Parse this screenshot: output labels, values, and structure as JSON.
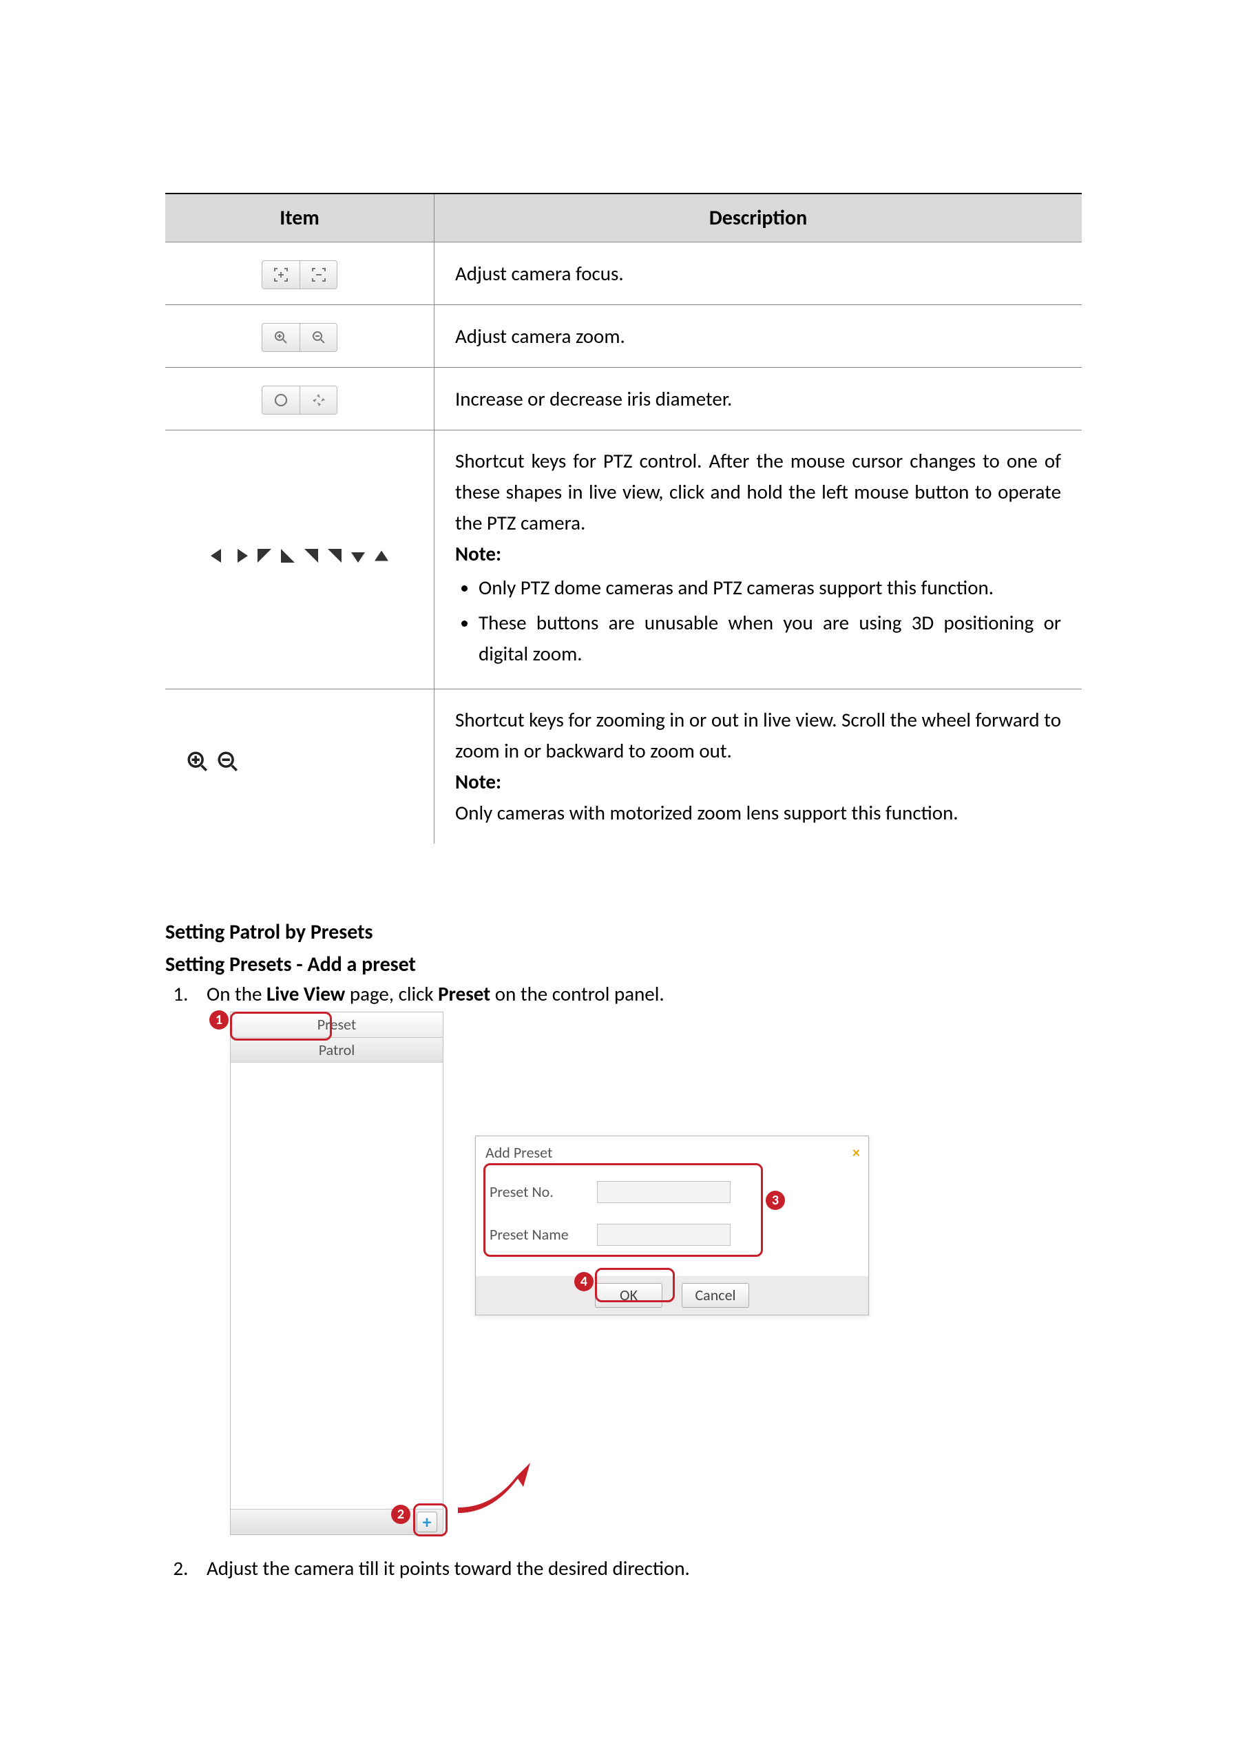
{
  "table": {
    "headers": {
      "item": "Item",
      "desc": "Description"
    },
    "rows": {
      "focus": {
        "desc": "Adjust camera focus."
      },
      "zoom": {
        "desc": "Adjust camera zoom."
      },
      "iris": {
        "desc": "Increase or decrease iris diameter."
      },
      "ptz": {
        "desc": "Shortcut keys for PTZ control. After the mouse cursor changes to one of these shapes in live view, click and hold the left mouse button to operate the PTZ camera.",
        "note_label": "Note:",
        "notes": [
          "Only PTZ dome cameras and PTZ cameras support this function.",
          "These buttons are unusable when you are using 3D positioning or digital zoom."
        ]
      },
      "scroll": {
        "desc": "Shortcut keys for zooming in or out in live view. Scroll the wheel forward to zoom in or backward to zoom out.",
        "note_label": "Note:",
        "note_line": "Only cameras with motorized zoom lens support this function."
      }
    }
  },
  "section": {
    "h1": "Setting Patrol by Presets",
    "h2": "Setting Presets - Add a preset"
  },
  "steps": {
    "s1_pre": "On the ",
    "s1_b1": "Live View",
    "s1_mid": " page, click ",
    "s1_b2": "Preset",
    "s1_post": " on the control panel.",
    "s2": "Adjust the camera till it points toward the desired direction."
  },
  "panel": {
    "tabs": {
      "preset": "Preset",
      "patrol": "Patrol"
    },
    "plus": "+",
    "dialog": {
      "title": "Add Preset",
      "close": "×",
      "preset_no_label": "Preset No.",
      "preset_name_label": "Preset Name",
      "ok": "OK",
      "cancel": "Cancel"
    }
  },
  "callouts": {
    "c1": "1",
    "c2": "2",
    "c3": "3",
    "c4": "4"
  }
}
